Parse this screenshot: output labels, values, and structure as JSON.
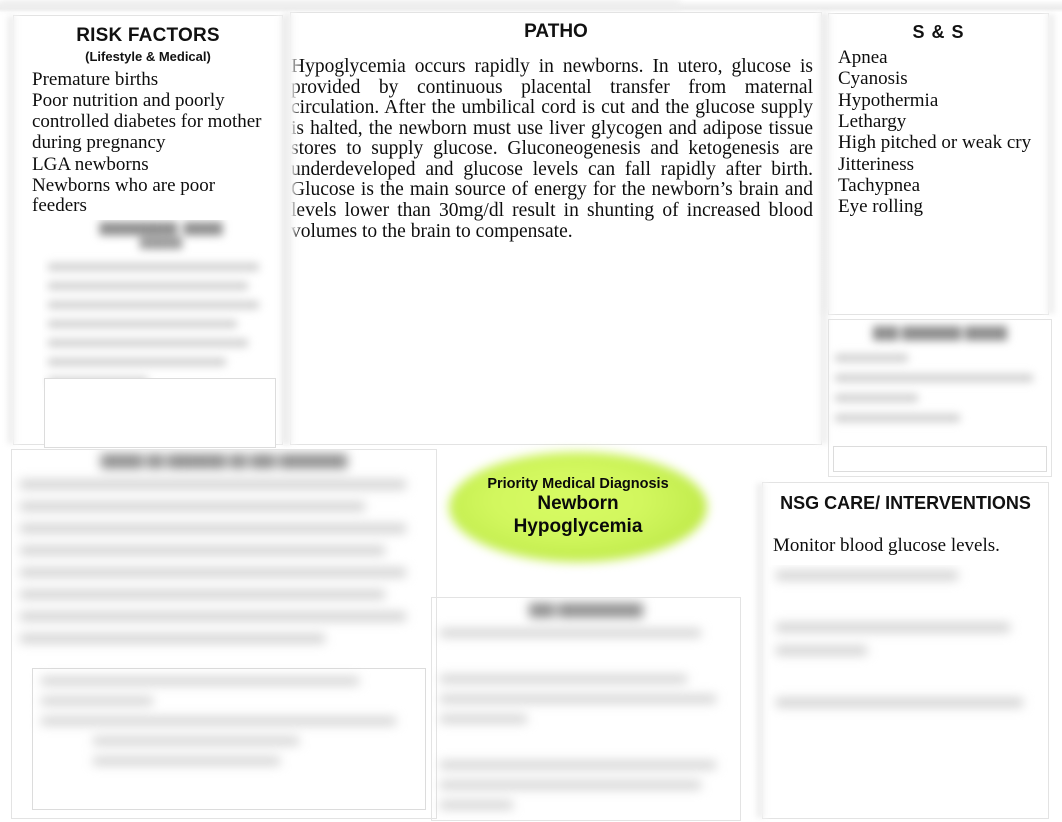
{
  "document": {
    "type": "nursing-concept-map",
    "title_visible": false
  },
  "risk_factors": {
    "heading": "RISK FACTORS",
    "subheading": "(Lifestyle & Medical)",
    "items": [
      "Premature births",
      "Poor nutrition and poorly",
      "controlled diabetes for mother",
      "during pregnancy",
      "LGA newborns",
      "Newborns who are poor feeders"
    ]
  },
  "patho": {
    "heading": "PATHO",
    "body": "Hypoglycemia occurs rapidly in newborns. In utero, glucose is provided by continuous placental transfer from maternal circulation. After the umbilical cord is cut and the glucose supply is halted, the newborn must use liver glycogen and adipose tissue stores to supply glucose. Gluconeogenesis and ketogenesis are underdeveloped and glucose levels can fall rapidly after birth. Glucose is the main source of energy for the newborn’s brain and levels lower than 30mg/dl result in shunting of increased blood volumes to the brain to compensate."
  },
  "signs_symptoms": {
    "heading": "S & S",
    "items": [
      "Apnea",
      "Cyanosis",
      "Hypothermia",
      "Lethargy",
      "High pitched or weak cry",
      "Jitteriness",
      "Tachypnea",
      "Eye rolling"
    ]
  },
  "diagnosis_oval": {
    "label": "Priority Medical Diagnosis",
    "line1": "Newborn",
    "line2": "Hypoglycemia",
    "fill_color": "#ccf254"
  },
  "nursing_care": {
    "heading": "NSG CARE/ INTERVENTIONS",
    "first_item": "Monitor blood glucose levels."
  },
  "blurred_regions": {
    "note": "illegible",
    "risk_sub_panel": "",
    "patho_lower": "",
    "signs_lower": "",
    "bottom_left": "",
    "bottom_center": "",
    "nursing_lower": ""
  }
}
